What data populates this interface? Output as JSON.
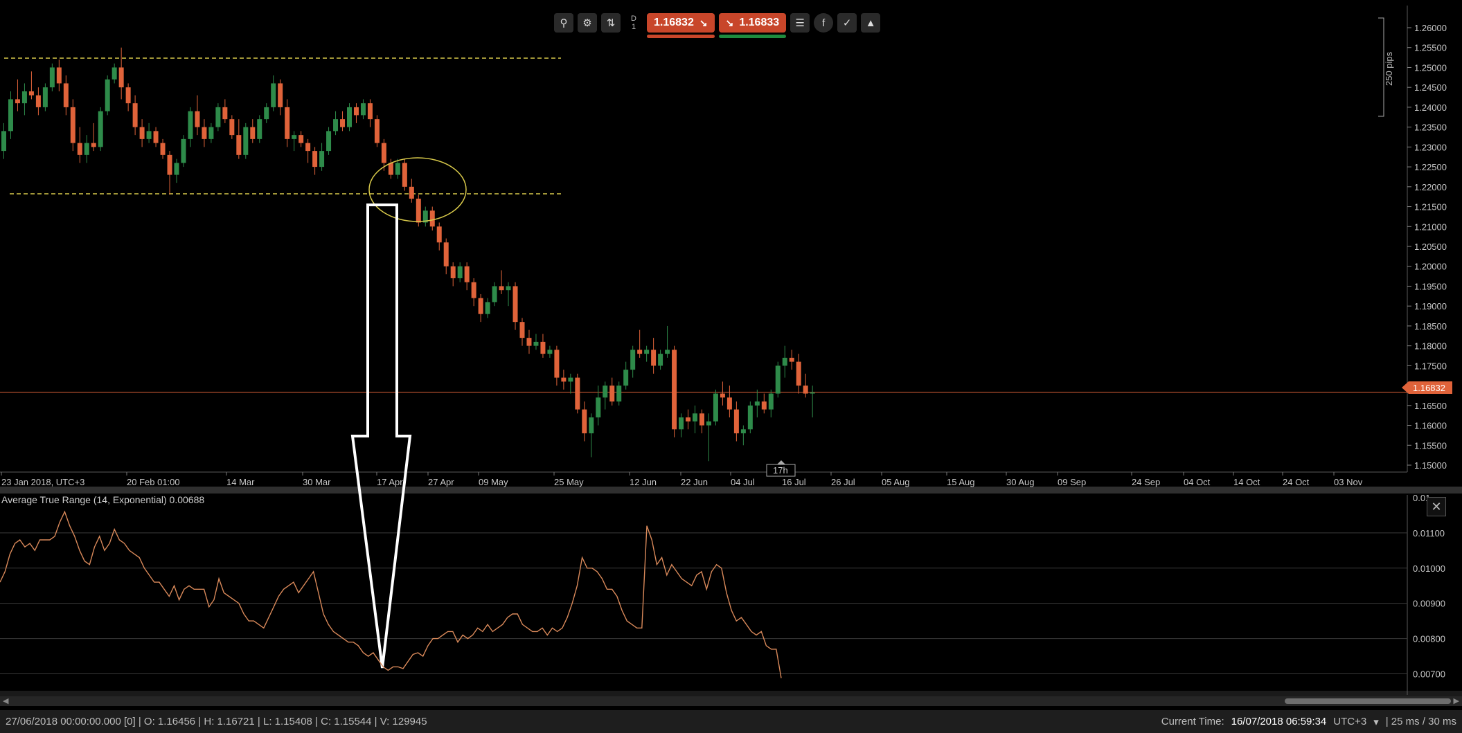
{
  "toolbar": {
    "timeframe_letter": "D",
    "timeframe_number": "1",
    "sell_price": "1.16832",
    "buy_price": "1.16833",
    "icons": [
      "zoom-icon",
      "chart-settings-icon",
      "chart-type-icon",
      "list-icon",
      "facebook-icon",
      "share-icon",
      "publish-icon"
    ]
  },
  "price_axis": {
    "ticks": [
      "1.26000",
      "1.25500",
      "1.25000",
      "1.24500",
      "1.24000",
      "1.23500",
      "1.23000",
      "1.22500",
      "1.22000",
      "1.21500",
      "1.21000",
      "1.20500",
      "1.20000",
      "1.19500",
      "1.19000",
      "1.18500",
      "1.18000",
      "1.17500",
      "1.17000",
      "1.16500",
      "1.16000",
      "1.15500",
      "1.15000"
    ],
    "current_price_label": "1.16832",
    "pips_label": "250 pips"
  },
  "time_axis": {
    "labels": [
      "23 Jan 2018, UTC+3",
      "20 Feb 01:00",
      "14 Mar",
      "30 Mar",
      "17 Apr",
      "27 Apr",
      "09 May",
      "25 May",
      "12 Jun",
      "22 Jun",
      "04 Jul",
      "16 Jul",
      "26 Jul",
      "05 Aug",
      "15 Aug",
      "30 Aug",
      "09 Sep",
      "24 Sep",
      "04 Oct",
      "14 Oct",
      "24 Oct",
      "03 Nov"
    ],
    "countdown": "17h"
  },
  "indicator": {
    "title": "Average True Range (14, Exponential) 0.00688",
    "ticks": [
      "0.01",
      "0.01100",
      "0.01000",
      "0.00900",
      "0.00800",
      "0.00700"
    ]
  },
  "statusbar": {
    "ohlc": "27/06/2018 00:00:00.000 [0] | O: 1.16456 | H: 1.16721 | L: 1.15408 | C: 1.15544 | V: 129945",
    "current_time_label": "Current Time:",
    "current_time_value": "16/07/2018 06:59:34",
    "timezone": "UTC+3",
    "latency": "| 25 ms / 30 ms"
  },
  "colors": {
    "background": "#000000",
    "bull": "#2e8b4a",
    "bear": "#e0633a",
    "atr_line": "#d9895a",
    "price_line": "#e0633a",
    "annotation": "#d8c94a"
  },
  "chart_data": [
    {
      "type": "candlestick",
      "title": "",
      "ylim": [
        1.148,
        1.262
      ],
      "candles": [
        [
          1.229,
          1.236,
          1.227,
          1.234
        ],
        [
          1.234,
          1.244,
          1.232,
          1.242
        ],
        [
          1.242,
          1.247,
          1.239,
          1.241
        ],
        [
          1.241,
          1.246,
          1.238,
          1.244
        ],
        [
          1.244,
          1.249,
          1.242,
          1.243
        ],
        [
          1.243,
          1.245,
          1.238,
          1.24
        ],
        [
          1.24,
          1.246,
          1.239,
          1.245
        ],
        [
          1.245,
          1.251,
          1.244,
          1.25
        ],
        [
          1.25,
          1.252,
          1.244,
          1.246
        ],
        [
          1.246,
          1.248,
          1.238,
          1.24
        ],
        [
          1.24,
          1.242,
          1.229,
          1.231
        ],
        [
          1.231,
          1.235,
          1.226,
          1.228
        ],
        [
          1.228,
          1.233,
          1.226,
          1.231
        ],
        [
          1.231,
          1.236,
          1.229,
          1.23
        ],
        [
          1.23,
          1.24,
          1.229,
          1.239
        ],
        [
          1.239,
          1.248,
          1.238,
          1.247
        ],
        [
          1.247,
          1.251,
          1.246,
          1.25
        ],
        [
          1.25,
          1.255,
          1.242,
          1.245
        ],
        [
          1.245,
          1.246,
          1.239,
          1.241
        ],
        [
          1.241,
          1.243,
          1.233,
          1.235
        ],
        [
          1.235,
          1.237,
          1.23,
          1.232
        ],
        [
          1.232,
          1.236,
          1.231,
          1.234
        ],
        [
          1.234,
          1.235,
          1.23,
          1.231
        ],
        [
          1.231,
          1.232,
          1.227,
          1.228
        ],
        [
          1.228,
          1.229,
          1.218,
          1.223
        ],
        [
          1.223,
          1.227,
          1.221,
          1.226
        ],
        [
          1.226,
          1.233,
          1.225,
          1.232
        ],
        [
          1.232,
          1.24,
          1.23,
          1.239
        ],
        [
          1.239,
          1.243,
          1.233,
          1.235
        ],
        [
          1.235,
          1.237,
          1.23,
          1.232
        ],
        [
          1.232,
          1.236,
          1.231,
          1.235
        ],
        [
          1.235,
          1.241,
          1.234,
          1.24
        ],
        [
          1.24,
          1.242,
          1.236,
          1.237
        ],
        [
          1.237,
          1.238,
          1.232,
          1.233
        ],
        [
          1.233,
          1.237,
          1.227,
          1.228
        ],
        [
          1.228,
          1.236,
          1.227,
          1.235
        ],
        [
          1.235,
          1.237,
          1.231,
          1.232
        ],
        [
          1.232,
          1.238,
          1.231,
          1.237
        ],
        [
          1.237,
          1.241,
          1.236,
          1.24
        ],
        [
          1.24,
          1.248,
          1.239,
          1.246
        ],
        [
          1.246,
          1.247,
          1.238,
          1.24
        ],
        [
          1.24,
          1.242,
          1.23,
          1.232
        ],
        [
          1.232,
          1.234,
          1.229,
          1.233
        ],
        [
          1.233,
          1.234,
          1.23,
          1.231
        ],
        [
          1.231,
          1.232,
          1.226,
          1.229
        ],
        [
          1.229,
          1.23,
          1.223,
          1.225
        ],
        [
          1.225,
          1.231,
          1.224,
          1.229
        ],
        [
          1.229,
          1.235,
          1.228,
          1.234
        ],
        [
          1.234,
          1.239,
          1.233,
          1.237
        ],
        [
          1.237,
          1.239,
          1.234,
          1.235
        ],
        [
          1.235,
          1.241,
          1.234,
          1.24
        ],
        [
          1.24,
          1.241,
          1.236,
          1.238
        ],
        [
          1.238,
          1.242,
          1.237,
          1.241
        ],
        [
          1.241,
          1.242,
          1.235,
          1.237
        ],
        [
          1.237,
          1.238,
          1.23,
          1.231
        ],
        [
          1.231,
          1.232,
          1.224,
          1.226
        ],
        [
          1.226,
          1.227,
          1.222,
          1.223
        ],
        [
          1.223,
          1.227,
          1.222,
          1.226
        ],
        [
          1.226,
          1.227,
          1.219,
          1.22
        ],
        [
          1.22,
          1.222,
          1.216,
          1.217
        ],
        [
          1.217,
          1.218,
          1.21,
          1.211
        ],
        [
          1.211,
          1.215,
          1.21,
          1.214
        ],
        [
          1.214,
          1.215,
          1.209,
          1.21
        ],
        [
          1.21,
          1.211,
          1.204,
          1.206
        ],
        [
          1.206,
          1.207,
          1.198,
          1.2
        ],
        [
          1.2,
          1.201,
          1.195,
          1.197
        ],
        [
          1.197,
          1.201,
          1.196,
          1.2
        ],
        [
          1.2,
          1.201,
          1.194,
          1.196
        ],
        [
          1.196,
          1.197,
          1.19,
          1.192
        ],
        [
          1.192,
          1.193,
          1.186,
          1.188
        ],
        [
          1.188,
          1.192,
          1.187,
          1.191
        ],
        [
          1.191,
          1.196,
          1.19,
          1.195
        ],
        [
          1.195,
          1.199,
          1.193,
          1.194
        ],
        [
          1.194,
          1.196,
          1.19,
          1.195
        ],
        [
          1.195,
          1.196,
          1.184,
          1.186
        ],
        [
          1.186,
          1.187,
          1.18,
          1.182
        ],
        [
          1.182,
          1.184,
          1.178,
          1.18
        ],
        [
          1.18,
          1.183,
          1.179,
          1.181
        ],
        [
          1.181,
          1.183,
          1.177,
          1.178
        ],
        [
          1.178,
          1.18,
          1.177,
          1.179
        ],
        [
          1.179,
          1.18,
          1.17,
          1.172
        ],
        [
          1.172,
          1.174,
          1.169,
          1.171
        ],
        [
          1.171,
          1.173,
          1.168,
          1.172
        ],
        [
          1.172,
          1.173,
          1.163,
          1.164
        ],
        [
          1.164,
          1.166,
          1.156,
          1.158
        ],
        [
          1.158,
          1.163,
          1.152,
          1.162
        ],
        [
          1.162,
          1.17,
          1.16,
          1.167
        ],
        [
          1.167,
          1.171,
          1.164,
          1.17
        ],
        [
          1.17,
          1.172,
          1.165,
          1.166
        ],
        [
          1.166,
          1.171,
          1.165,
          1.17
        ],
        [
          1.17,
          1.176,
          1.169,
          1.174
        ],
        [
          1.174,
          1.18,
          1.172,
          1.179
        ],
        [
          1.179,
          1.184,
          1.177,
          1.178
        ],
        [
          1.178,
          1.18,
          1.176,
          1.179
        ],
        [
          1.179,
          1.182,
          1.173,
          1.175
        ],
        [
          1.175,
          1.179,
          1.174,
          1.178
        ],
        [
          1.178,
          1.185,
          1.177,
          1.179
        ],
        [
          1.179,
          1.18,
          1.157,
          1.159
        ],
        [
          1.159,
          1.163,
          1.157,
          1.162
        ],
        [
          1.162,
          1.164,
          1.159,
          1.161
        ],
        [
          1.161,
          1.165,
          1.158,
          1.163
        ],
        [
          1.163,
          1.164,
          1.158,
          1.16
        ],
        [
          1.16,
          1.163,
          1.151,
          1.161
        ],
        [
          1.161,
          1.169,
          1.16,
          1.168
        ],
        [
          1.168,
          1.171,
          1.165,
          1.167
        ],
        [
          1.167,
          1.17,
          1.162,
          1.164
        ],
        [
          1.164,
          1.166,
          1.156,
          1.158
        ],
        [
          1.158,
          1.16,
          1.155,
          1.159
        ],
        [
          1.159,
          1.166,
          1.158,
          1.165
        ],
        [
          1.165,
          1.169,
          1.162,
          1.166
        ],
        [
          1.166,
          1.168,
          1.163,
          1.164
        ],
        [
          1.164,
          1.169,
          1.162,
          1.168
        ],
        [
          1.168,
          1.176,
          1.167,
          1.175
        ],
        [
          1.175,
          1.18,
          1.172,
          1.177
        ],
        [
          1.177,
          1.179,
          1.174,
          1.176
        ],
        [
          1.176,
          1.178,
          1.168,
          1.17
        ],
        [
          1.17,
          1.173,
          1.167,
          1.168
        ],
        [
          1.168,
          1.17,
          1.162,
          1.1683
        ]
      ]
    },
    {
      "type": "line",
      "title": "Average True Range (14, Exponential) 0.00688",
      "ylim": [
        0.0065,
        0.0119
      ],
      "series": [
        {
          "values": [
            0.0096,
            0.0099,
            0.0104,
            0.0107,
            0.0108,
            0.0106,
            0.0107,
            0.0105,
            0.0108,
            0.0108,
            0.0108,
            0.0109,
            0.0113,
            0.0116,
            0.0112,
            0.0109,
            0.0105,
            0.0102,
            0.0101,
            0.0106,
            0.0109,
            0.0105,
            0.0107,
            0.0111,
            0.0108,
            0.0107,
            0.0105,
            0.0104,
            0.0103,
            0.01,
            0.0098,
            0.0096,
            0.0096,
            0.0094,
            0.0092,
            0.0095,
            0.0091,
            0.0094,
            0.0095,
            0.0094,
            0.0094,
            0.0094,
            0.0089,
            0.0091,
            0.0097,
            0.0093,
            0.0092,
            0.0091,
            0.009,
            0.0087,
            0.0085,
            0.0085,
            0.0084,
            0.0083,
            0.0086,
            0.0089,
            0.0092,
            0.0094,
            0.0095,
            0.0096,
            0.0093,
            0.0095,
            0.0097,
            0.0099,
            0.0093,
            0.0087,
            0.0084,
            0.0082,
            0.0081,
            0.008,
            0.0079,
            0.0079,
            0.0078,
            0.0076,
            0.0075,
            0.0076,
            0.0074,
            0.0072,
            0.0071,
            0.0072,
            0.0072,
            0.00715,
            0.00735,
            0.00755,
            0.0076,
            0.0075,
            0.0078,
            0.008,
            0.008,
            0.0081,
            0.0082,
            0.0082,
            0.0079,
            0.0081,
            0.008,
            0.0081,
            0.0083,
            0.0082,
            0.0084,
            0.0082,
            0.0083,
            0.0084,
            0.0086,
            0.0087,
            0.0087,
            0.0084,
            0.0083,
            0.0082,
            0.0082,
            0.0083,
            0.0081,
            0.0083,
            0.0082,
            0.0083,
            0.0086,
            0.009,
            0.0095,
            0.0103,
            0.01,
            0.01,
            0.0099,
            0.0097,
            0.0094,
            0.0094,
            0.0092,
            0.0088,
            0.0085,
            0.0084,
            0.0083,
            0.0083,
            0.0112,
            0.0108,
            0.0101,
            0.0103,
            0.0098,
            0.0101,
            0.0099,
            0.0097,
            0.0096,
            0.0095,
            0.0098,
            0.0099,
            0.0094,
            0.0099,
            0.0101,
            0.01,
            0.0093,
            0.0088,
            0.0085,
            0.0086,
            0.0084,
            0.0082,
            0.0081,
            0.0082,
            0.0078,
            0.0077,
            0.0077,
            0.00688
          ]
        }
      ]
    }
  ]
}
